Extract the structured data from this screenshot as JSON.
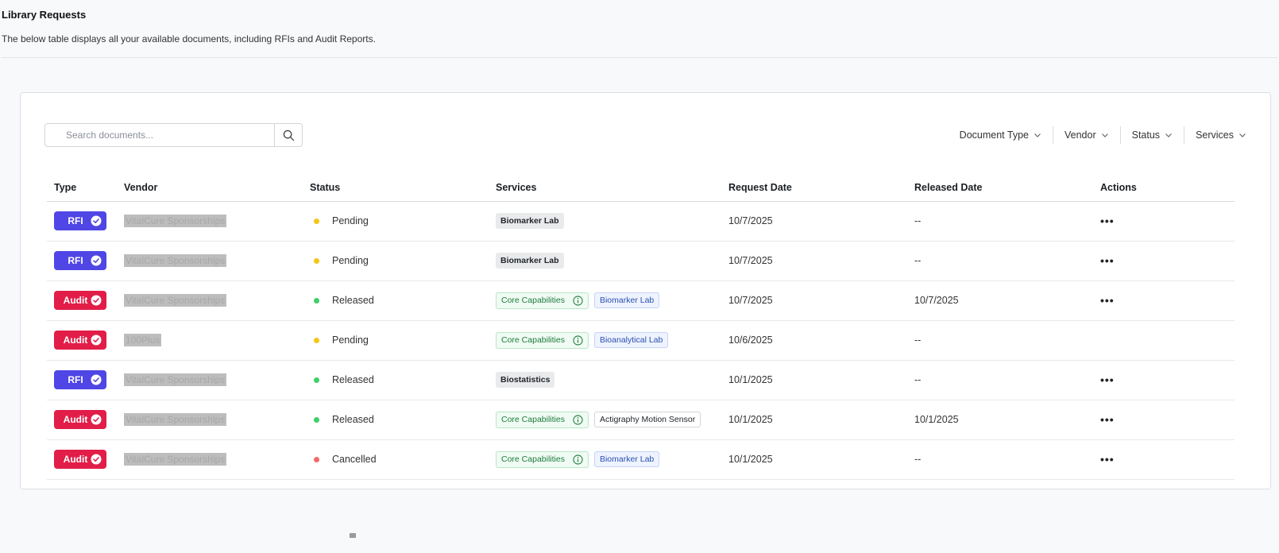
{
  "header": {
    "title": "Library Requests",
    "subtitle": "The below table displays all your available documents, including RFIs and Audit Reports."
  },
  "search": {
    "placeholder": "Search documents..."
  },
  "filters": [
    "Document Type",
    "Vendor",
    "Status",
    "Services"
  ],
  "table": {
    "columns": [
      "Type",
      "Vendor",
      "Status",
      "Services",
      "Request Date",
      "Released Date",
      "Actions"
    ],
    "rows": [
      {
        "type": "RFI",
        "vendor": "VitalCure Sponsorships",
        "status": "Pending",
        "status_color": "#f5c518",
        "services": [
          {
            "kind": "gray",
            "label": "Biomarker Lab"
          }
        ],
        "request_date": "10/7/2025",
        "released_date": "--",
        "actions": "•••"
      },
      {
        "type": "RFI",
        "vendor": "VitalCure Sponsorships",
        "status": "Pending",
        "status_color": "#f5c518",
        "services": [
          {
            "kind": "gray",
            "label": "Biomarker Lab"
          }
        ],
        "request_date": "10/7/2025",
        "released_date": "--",
        "actions": "•••"
      },
      {
        "type": "Audit",
        "vendor": "VitalCure Sponsorships",
        "status": "Released",
        "status_color": "#3ecf6a",
        "services": [
          {
            "kind": "green",
            "label": "Core Capabilities"
          },
          {
            "kind": "blue",
            "label": "Biomarker Lab"
          }
        ],
        "request_date": "10/7/2025",
        "released_date": "10/7/2025",
        "actions": "•••"
      },
      {
        "type": "Audit",
        "vendor": "100Plus",
        "status": "Pending",
        "status_color": "#f5c518",
        "services": [
          {
            "kind": "green",
            "label": "Core Capabilities"
          },
          {
            "kind": "blue",
            "label": "Bioanalytical Lab"
          }
        ],
        "request_date": "10/6/2025",
        "released_date": "--",
        "actions": ""
      },
      {
        "type": "RFI",
        "vendor": "VitalCure Sponsorships",
        "status": "Released",
        "status_color": "#3ecf6a",
        "services": [
          {
            "kind": "gray",
            "label": "Biostatistics"
          }
        ],
        "request_date": "10/1/2025",
        "released_date": "--",
        "actions": "•••"
      },
      {
        "type": "Audit",
        "vendor": "VitalCure Sponsorships",
        "status": "Released",
        "status_color": "#3ecf6a",
        "services": [
          {
            "kind": "green",
            "label": "Core Capabilities"
          },
          {
            "kind": "outline",
            "label": "Actigraphy Motion Sensor"
          }
        ],
        "request_date": "10/1/2025",
        "released_date": "10/1/2025",
        "actions": "•••"
      },
      {
        "type": "Audit",
        "vendor": "VitalCure Sponsorships",
        "status": "Cancelled",
        "status_color": "#f26b6b",
        "services": [
          {
            "kind": "green",
            "label": "Core Capabilities"
          },
          {
            "kind": "blue",
            "label": "Biomarker Lab"
          }
        ],
        "request_date": "10/1/2025",
        "released_date": "--",
        "actions": "•••"
      }
    ]
  },
  "colors": {
    "rfi": "#4f46e5",
    "audit": "#e11d48"
  },
  "icons": {
    "search": "search-icon",
    "chevron": "chevron-down-icon",
    "check": "check-circle-icon",
    "info": "info-icon"
  }
}
